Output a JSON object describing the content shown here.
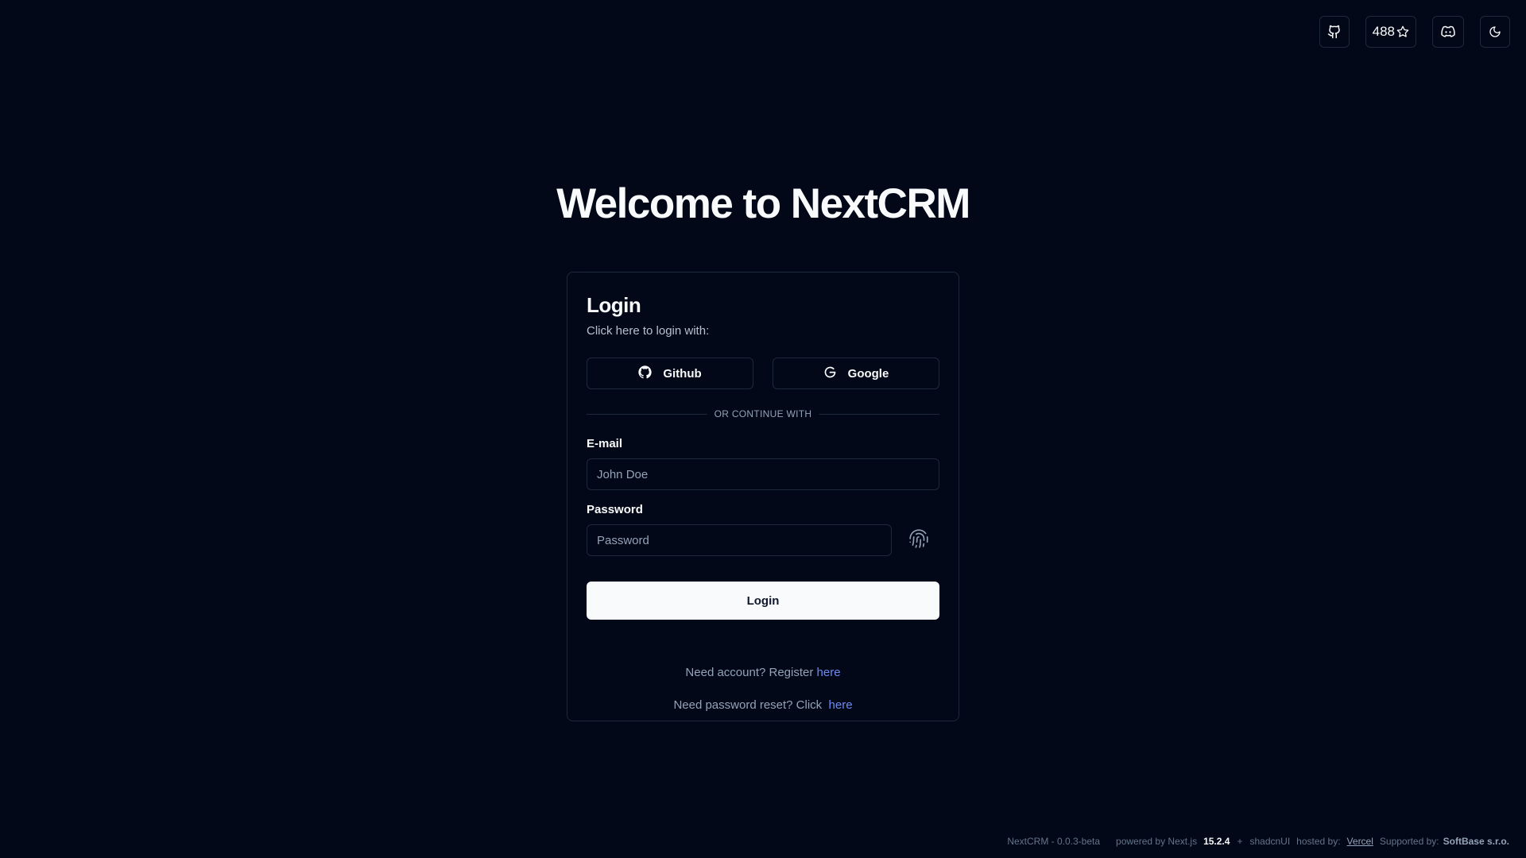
{
  "topbar": {
    "github_icon": "github-icon",
    "stars_count": "488",
    "star_icon": "star-icon",
    "discord_icon": "discord-icon",
    "theme_icon": "moon-icon"
  },
  "page": {
    "title": "Welcome to NextCRM"
  },
  "login_card": {
    "title": "Login",
    "description": "Click here to login with:",
    "github_label": "Github",
    "google_label": "Google",
    "divider_text": "OR CONTINUE WITH",
    "email_label": "E-mail",
    "email_placeholder": "John Doe",
    "password_label": "Password",
    "password_placeholder": "Password",
    "fingerprint_icon": "fingerprint-icon",
    "login_button": "Login",
    "register_prompt": "Need account? Register",
    "register_link": "here",
    "reset_prompt": "Need password reset? Click",
    "reset_link": "here"
  },
  "footer": {
    "version": "NextCRM - 0.0.3-beta",
    "powered_by": "powered by Next.js",
    "next_version": "15.2.4",
    "plus": "+",
    "ui_lib": "shadcnUI",
    "hosted_by": "hosted by:",
    "host": "Vercel",
    "supported_by": "Supported by:",
    "supporter": "SoftBase s.r.o."
  },
  "colors": {
    "background": "#020817",
    "border": "#1e293b",
    "foreground": "#f8fafc",
    "muted": "#94a3b8",
    "link": "#6d8bf5"
  }
}
